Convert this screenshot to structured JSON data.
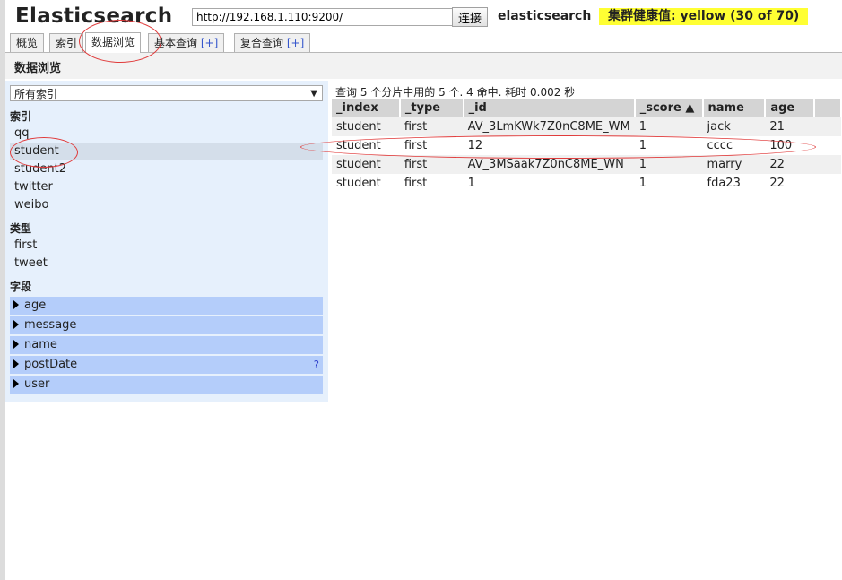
{
  "header": {
    "logo": "Elasticsearch",
    "url": "http://192.168.1.110:9200/",
    "connect_label": "连接",
    "cluster_name": "elasticsearch",
    "health_text": "集群健康值: yellow (30 of 70)",
    "health_color": "#ffff33"
  },
  "tabs": [
    {
      "label": "概览"
    },
    {
      "label": "索引"
    },
    {
      "label": "数据浏览",
      "active": true
    },
    {
      "label": "基本查询",
      "plus": "[+]"
    },
    {
      "label": "复合查询",
      "plus": "[+]"
    }
  ],
  "page_title": "数据浏览",
  "sidebar": {
    "index_select": "所有索引",
    "indices_header": "索引",
    "indices": [
      "qq",
      "student",
      "student2",
      "twitter",
      "weibo"
    ],
    "selected_index": "student",
    "types_header": "类型",
    "types": [
      "first",
      "tweet"
    ],
    "fields_header": "字段",
    "fields": [
      "age",
      "message",
      "name",
      "postDate",
      "user"
    ],
    "help_mark": "?"
  },
  "results": {
    "query_info": "查询 5 个分片中用的 5 个. 4 命中. 耗时 0.002 秒",
    "columns": [
      "_index",
      "_type",
      "_id",
      "_score",
      "name",
      "age"
    ],
    "sort_indicator": "▲",
    "rows": [
      [
        "student",
        "first",
        "AV_3LmKWk7Z0nC8ME_WM",
        "1",
        "jack",
        "21"
      ],
      [
        "student",
        "first",
        "12",
        "1",
        "cccc",
        "100"
      ],
      [
        "student",
        "first",
        "AV_3MSaak7Z0nC8ME_WN",
        "1",
        "marry",
        "22"
      ],
      [
        "student",
        "first",
        "1",
        "1",
        "fda23",
        "22"
      ]
    ]
  },
  "accent_color": "#e03a3a"
}
